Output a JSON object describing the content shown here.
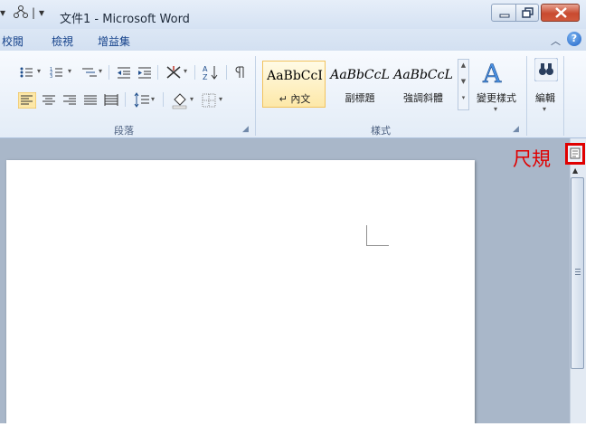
{
  "window": {
    "title": "文件1 - Microsoft Word",
    "qat_separator": "|",
    "qat_dropdown": "▾"
  },
  "tabs": [
    "校閱",
    "檢視",
    "增益集"
  ],
  "ribbon": {
    "paragraph_group": "段落",
    "styles_group": "樣式",
    "styles": [
      {
        "sample": "AaBbCcI",
        "name": "↵ 內文"
      },
      {
        "sample": "AaBbCcL",
        "name": "副標題"
      },
      {
        "sample": "AaBbCcL",
        "name": "強調斜體"
      }
    ],
    "change_styles": "變更樣式",
    "editing": "編輯"
  },
  "annotation": {
    "ruler_label": "尺規"
  },
  "colors": {
    "accent": "#1e62c7",
    "highlight": "#e00000",
    "selected_style": "#fde8a8"
  }
}
